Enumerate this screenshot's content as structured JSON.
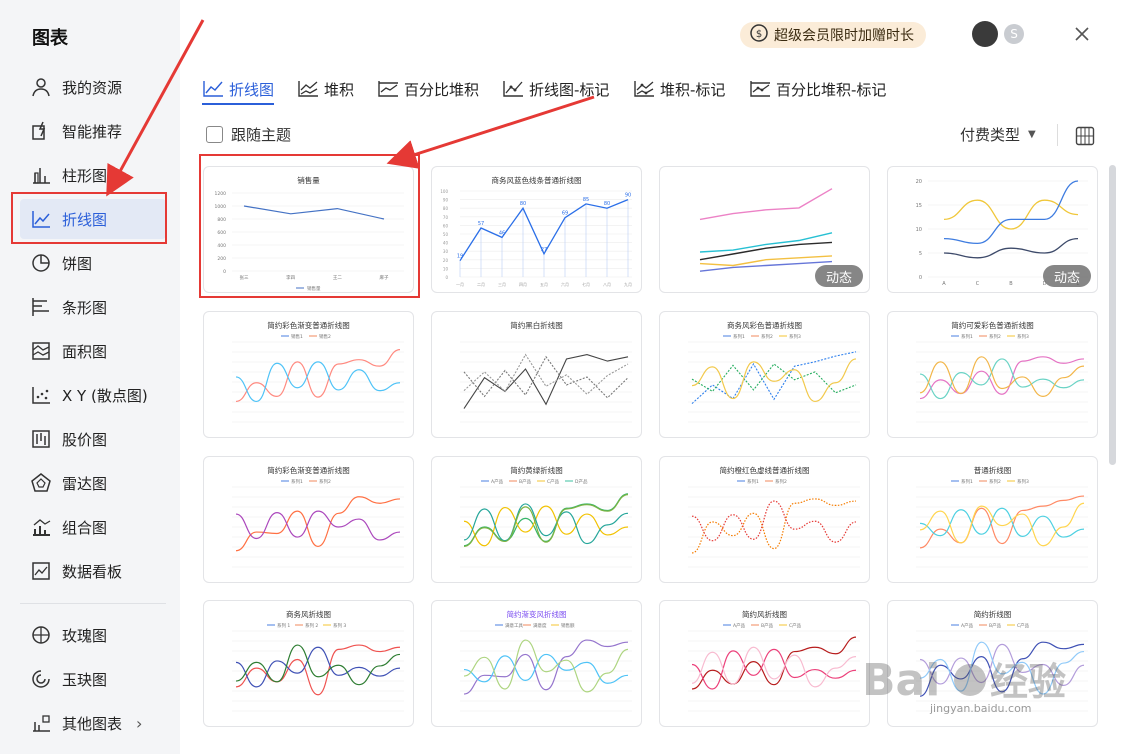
{
  "sidebar": {
    "title": "图表",
    "items": [
      {
        "label": "我的资源",
        "icon": "user-icon"
      },
      {
        "label": "智能推荐",
        "icon": "smart-icon"
      },
      {
        "label": "柱形图",
        "icon": "bar-chart-icon"
      },
      {
        "label": "折线图",
        "icon": "line-chart-icon",
        "active": true
      },
      {
        "label": "饼图",
        "icon": "pie-chart-icon"
      },
      {
        "label": "条形图",
        "icon": "hbar-chart-icon"
      },
      {
        "label": "面积图",
        "icon": "area-chart-icon"
      },
      {
        "label": "X Y (散点图)",
        "icon": "scatter-chart-icon"
      },
      {
        "label": "股价图",
        "icon": "stock-chart-icon"
      },
      {
        "label": "雷达图",
        "icon": "radar-chart-icon"
      },
      {
        "label": "组合图",
        "icon": "combo-chart-icon"
      },
      {
        "label": "数据看板",
        "icon": "dashboard-icon"
      },
      {
        "label": "玫瑰图",
        "icon": "rose-chart-icon"
      },
      {
        "label": "玉玦图",
        "icon": "ring-chart-icon"
      },
      {
        "label": "其他图表",
        "icon": "other-chart-icon",
        "chevron": "›"
      }
    ]
  },
  "header": {
    "promo": "超级会员限时加赠时长"
  },
  "tabs": [
    {
      "label": "折线图",
      "active": true
    },
    {
      "label": "堆积"
    },
    {
      "label": "百分比堆积"
    },
    {
      "label": "折线图-标记"
    },
    {
      "label": "堆积-标记"
    },
    {
      "label": "百分比堆积-标记"
    }
  ],
  "toolbar": {
    "follow_theme": "跟随主题",
    "paid_type": "付费类型",
    "caret": "▼"
  },
  "colors": {
    "accent": "#2b5fd9",
    "annotation": "#e53935",
    "badge_bg": "#646464"
  },
  "cards": [
    {
      "title": "销售量",
      "x": [
        "张三",
        "李四",
        "王二",
        "麻子"
      ],
      "yticks": [
        "0",
        "200",
        "400",
        "600",
        "800",
        "1000",
        "1200"
      ],
      "values": [
        1000,
        880,
        960,
        800
      ],
      "legend": [
        "销售量"
      ]
    },
    {
      "title": "商务风蓝色线条普通折线图",
      "x": [
        "一月",
        "二月",
        "三月",
        "四月",
        "五月",
        "六月",
        "七月",
        "八月",
        "九月"
      ],
      "yticks": [
        "0",
        "10",
        "20",
        "30",
        "40",
        "50",
        "60",
        "70",
        "80",
        "90",
        "100"
      ],
      "values": [
        19,
        57,
        46,
        80,
        27,
        69,
        85,
        80,
        90
      ]
    },
    {
      "title": "",
      "badge": "动态"
    },
    {
      "title": "",
      "badge": "动态",
      "x": [
        "A",
        "C",
        "B",
        "D",
        "E"
      ],
      "yticks": [
        "0",
        "5",
        "10",
        "15",
        "20"
      ]
    },
    {
      "title": "简约彩色渐变普通折线图",
      "legend": [
        "销售1",
        "销售2"
      ]
    },
    {
      "title": "简约黑白折线图"
    },
    {
      "title": "商务风彩色普通折线图",
      "legend": [
        "系列1",
        "系列2",
        "系列3"
      ]
    },
    {
      "title": "简约可爱彩色普通折线图",
      "legend": [
        "系列1",
        "系列2",
        "系列3"
      ]
    },
    {
      "title": "简约彩色渐变普通折线图",
      "legend": [
        "系列1",
        "系列2"
      ]
    },
    {
      "title": "简约黄绿折线图",
      "legend": [
        "A产品",
        "B产品",
        "C产品",
        "D产品"
      ]
    },
    {
      "title": "简约橙红色虚线普通折线图",
      "legend": [
        "系列1",
        "系列2"
      ]
    },
    {
      "title": "普通折线图",
      "legend": [
        "系列1",
        "系列2",
        "系列3"
      ]
    },
    {
      "title": "商务风折线图",
      "legend": [
        "系列 1",
        "系列 2",
        "系列 3"
      ]
    },
    {
      "title": "简约渐变风折线图",
      "legend": [
        "满意工具",
        "满意度",
        "销售额"
      ]
    },
    {
      "title": "简约风折线图",
      "legend": [
        "A产品",
        "B产品",
        "C产品"
      ]
    },
    {
      "title": "简约折线图",
      "legend": [
        "A产品",
        "B产品",
        "C产品"
      ]
    }
  ],
  "watermark": {
    "text": "jingyan.baidu.com"
  }
}
